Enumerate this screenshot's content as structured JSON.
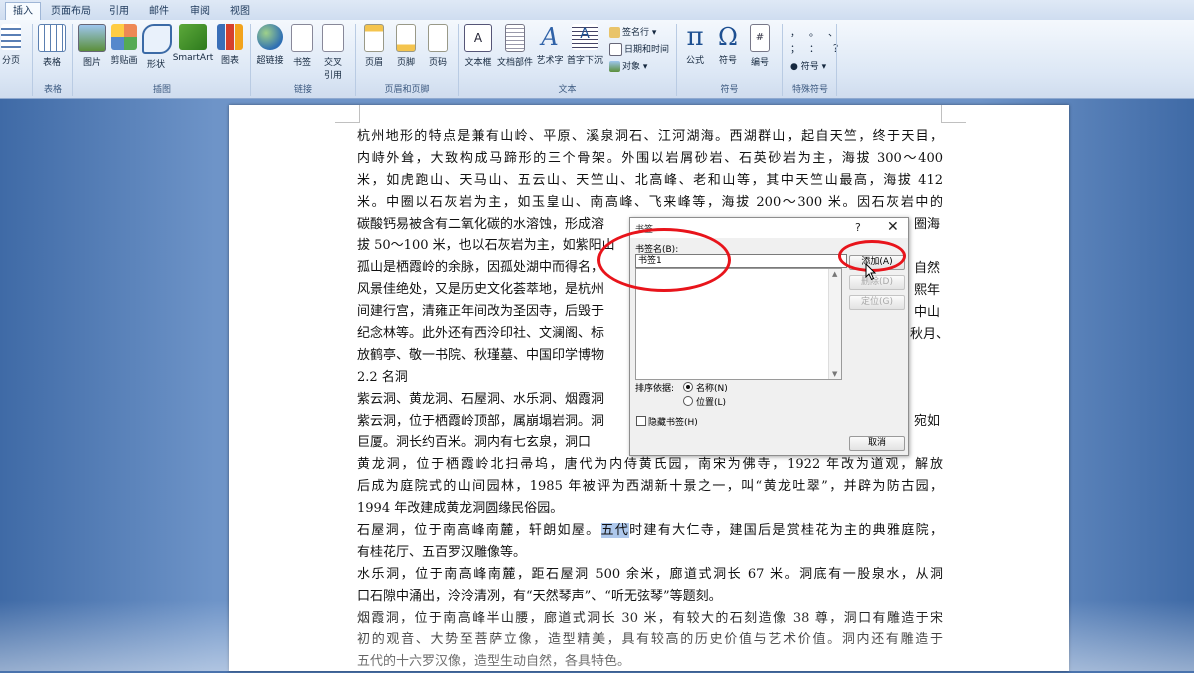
{
  "tabs": [
    "插入",
    "页面布局",
    "引用",
    "邮件",
    "审阅",
    "视图"
  ],
  "ribbon": {
    "buttons": {
      "page_break": "分页",
      "table": "表格",
      "picture": "图片",
      "clipart": "剪贴画",
      "shapes": "形状",
      "smartart": "SmartArt",
      "chart": "图表",
      "hyperlink": "超链接",
      "bookmark": "书签",
      "cross_ref_1": "交叉",
      "cross_ref_2": "引用",
      "header": "页眉",
      "footer": "页脚",
      "page_number": "页码",
      "textbox": "文本框",
      "quickparts": "文档部件",
      "wordart": "艺术字",
      "dropcap": "首字下沉",
      "signature": "签名行",
      "datetime": "日期和时间",
      "object": "对象",
      "equation": "公式",
      "symbol": "符号",
      "numbering": "编号",
      "special_symbol": "符号"
    },
    "groups": {
      "table": "表格",
      "illustrations": "插图",
      "links": "链接",
      "header_footer": "页眉和页脚",
      "text": "文本",
      "symbols": "符号",
      "special": "特殊符号"
    },
    "special_glyphs": [
      "，",
      "。",
      "、",
      "；",
      "：",
      "？"
    ]
  },
  "document": {
    "lines": [
      "杭州地形的特点是兼有山岭、平原、溪泉洞石、江河湖海。西湖群山，起自天竺，终于天目，",
      "内峙外耸，大致构成马蹄形的三个骨架。外围以岩屑砂岩、石英砂岩为主，海拔 300～400",
      "米，如虎跑山、天马山、五云山、天竺山、北高峰、老和山等，其中天竺山最高，海拔 412",
      "米。中圈以石灰岩为主，如玉皇山、南高峰、飞来峰等，海拔 200～300 米。因石灰岩中的",
      "碳酸钙易被含有二氧化碳的水溶蚀，形成溶",
      "拔 50～100 米，也以石灰岩为主，如紫阳山",
      "孤山是栖霞岭的余脉，因孤处湖中而得名，",
      "风景佳绝处，又是历史文化荟萃地，是杭州",
      "间建行宫，清雍正年间改为圣因寺，后毁于",
      "纪念林等。此外还有西泠印社、文澜阁、标",
      "放鹤亭、敬一书院、秋瑾墓、中国印学博物",
      "2.2 名洞",
      "紫云洞、黄龙洞、石屋洞、水乐洞、烟霞洞",
      "紫云洞，位于栖霞岭顶部，属崩塌岩洞。洞",
      "巨厦。洞长约百米。洞内有七玄泉，洞口",
      "黄龙洞，位于栖霞岭北扫帚坞，唐代为内侍黄氏园，南宋为佛寺，1922 年改为道观，解放",
      "后成为庭院式的山间园林，1985 年被评为西湖新十景之一，叫“黄龙吐翠”，并辟为防古园，",
      "1994 年改建成黄龙洞圆缘民俗园。",
      "",
      "有桂花厅、五百罗汉雕像等。",
      "水乐洞，位于南高峰南麓，距石屋洞 500 余米，廊道式洞长 67 米。洞底有一股泉水，从洞",
      "口石隙中涌出，泠泠清冽，有“天然琴声”、“听无弦琴”等题刻。",
      "烟霞洞，位于南高峰半山腰，廊道式洞长 30 米，有较大的石刻造像 38 尊，洞口有雕造于宋",
      "初的观音、大势至菩萨立像，造型精美，具有较高的历史价值与艺术价值。洞内还有雕造于",
      "五代的十六罗汉像，造型生动自然，各具特色。"
    ],
    "shiwu_line": {
      "before": "石屋洞，位于南高峰南麓，轩朗如屋。",
      "selected": "五代",
      "after": "时建有大仁寺，建国后是赏桂花为主的典雅庭院，"
    },
    "right_fragments": [
      "圈海",
      "自然",
      "熙年",
      "中山",
      "秋月、",
      "宛如"
    ]
  },
  "dialog": {
    "title": "书签",
    "help": "?",
    "close": "✕",
    "name_label": "书签名(B):",
    "name_value": "书签1",
    "sort_label": "排序依据:",
    "sort_name": "名称(N)",
    "sort_location": "位置(L)",
    "hidden_label": "隐藏书签(H)",
    "add": "添加(A)",
    "delete": "删除(D)",
    "goto": "定位(G)",
    "cancel": "取消"
  }
}
